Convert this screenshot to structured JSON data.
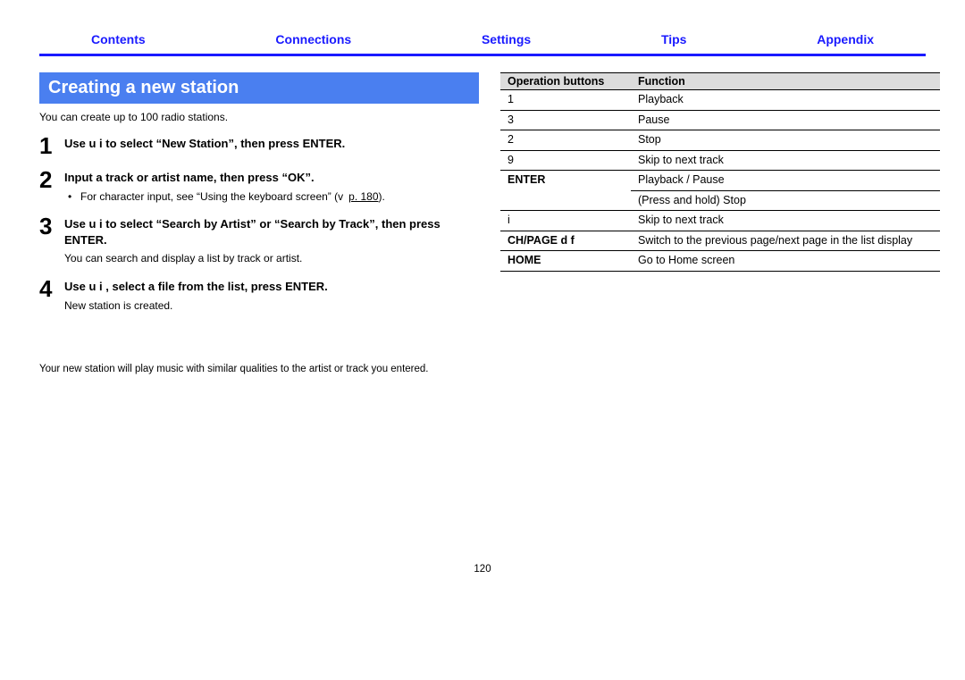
{
  "nav": {
    "contents": "Contents",
    "connections": "Connections",
    "settings": "Settings",
    "tips": "Tips",
    "appendix": "Appendix"
  },
  "section_heading": "Creating a new station",
  "intro_text": "You can create up to 100 radio stations.",
  "steps": {
    "s1": {
      "num": "1",
      "title": "Use u i  to select “New Station”, then press ENTER."
    },
    "s2": {
      "num": "2",
      "title": "Input a track or artist name, then press “OK”.",
      "bullet_pre": "For character input, see “Using the keyboard screen” (v ",
      "bullet_link": "p. 180",
      "bullet_post": ")."
    },
    "s3": {
      "num": "3",
      "title": "Use u i  to select “Search by Artist” or “Search by Track”, then press ENTER.",
      "note": "You can search and display a list by track or artist."
    },
    "s4": {
      "num": "4",
      "title": "Use u i , select a file from the list, press ENTER.",
      "note": "New station is created."
    }
  },
  "footnote": "Your new station will play music with similar qualities to the artist or track you entered.",
  "table": {
    "head_button": "Operation buttons",
    "head_function": "Function",
    "rows": {
      "r0": {
        "b": "1",
        "f": "Playback"
      },
      "r1": {
        "b": "3",
        "f": "Pause"
      },
      "r2": {
        "b": "2",
        "f": "Stop"
      },
      "r3": {
        "b": "9",
        "f": "Skip to next track"
      },
      "r4": {
        "b": "ENTER",
        "f1": "Playback / Pause",
        "f2": "(Press and hold) Stop"
      },
      "r5": {
        "b": "i",
        "f": "Skip to next track"
      },
      "r6": {
        "b": "CH/PAGE d f",
        "f": "Switch to the previous page/next page in the list display"
      },
      "r7": {
        "b": "HOME",
        "f": "Go to Home screen"
      }
    }
  },
  "page_number": "120"
}
